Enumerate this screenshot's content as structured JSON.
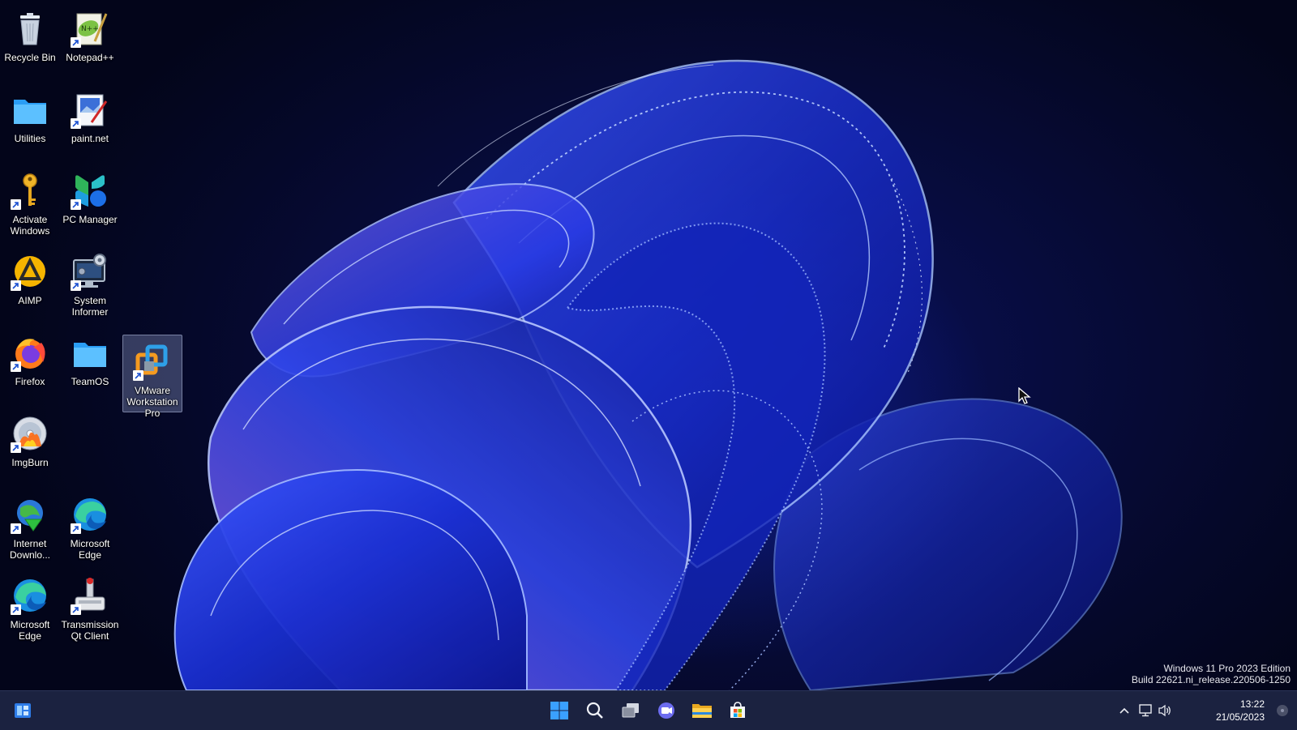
{
  "desktop": {
    "icons": [
      {
        "label": "Recycle Bin",
        "icon": "recycle-bin-icon"
      },
      {
        "label": "Notepad++",
        "icon": "notepad-plus-plus-icon"
      },
      {
        "label": "Utilities",
        "icon": "folder-icon"
      },
      {
        "label": "paint.net",
        "icon": "paint-net-icon"
      },
      {
        "label": "Activate Windows",
        "icon": "key-icon"
      },
      {
        "label": "PC Manager",
        "icon": "pc-manager-icon"
      },
      {
        "label": "AIMP",
        "icon": "aimp-icon"
      },
      {
        "label": "System Informer",
        "icon": "system-informer-icon"
      },
      {
        "label": "Firefox",
        "icon": "firefox-icon"
      },
      {
        "label": "TeamOS",
        "icon": "folder-icon"
      },
      {
        "label": "VMware Workstation Pro",
        "icon": "vmware-icon",
        "selected": true
      },
      {
        "label": "ImgBurn",
        "icon": "imgburn-icon"
      },
      {
        "label": "Internet Downlo...",
        "icon": "internet-download-manager-icon"
      },
      {
        "label": "Microsoft Edge",
        "icon": "edge-icon"
      },
      {
        "label": "Microsoft Edge",
        "icon": "edge-icon"
      },
      {
        "label": "Transmission Qt Client",
        "icon": "transmission-icon"
      }
    ]
  },
  "watermark": {
    "line1": "Windows 11 Pro 2023 Edition",
    "line2": "Build 22621.ni_release.220506-1250"
  },
  "taskbar": {
    "left_widget": "widgets-icon",
    "pinned": [
      "start-icon",
      "search-icon",
      "task-view-icon",
      "teams-chat-icon",
      "file-explorer-icon",
      "microsoft-store-icon"
    ],
    "tray": [
      "chevron-up-icon",
      "network-icon",
      "volume-icon"
    ],
    "clock": {
      "time": "13:22",
      "date": "21/05/2023"
    }
  },
  "colors": {
    "taskbar_bg": "#1b2240",
    "selection": "#a0afdc",
    "accent": "#2a7cf0"
  }
}
